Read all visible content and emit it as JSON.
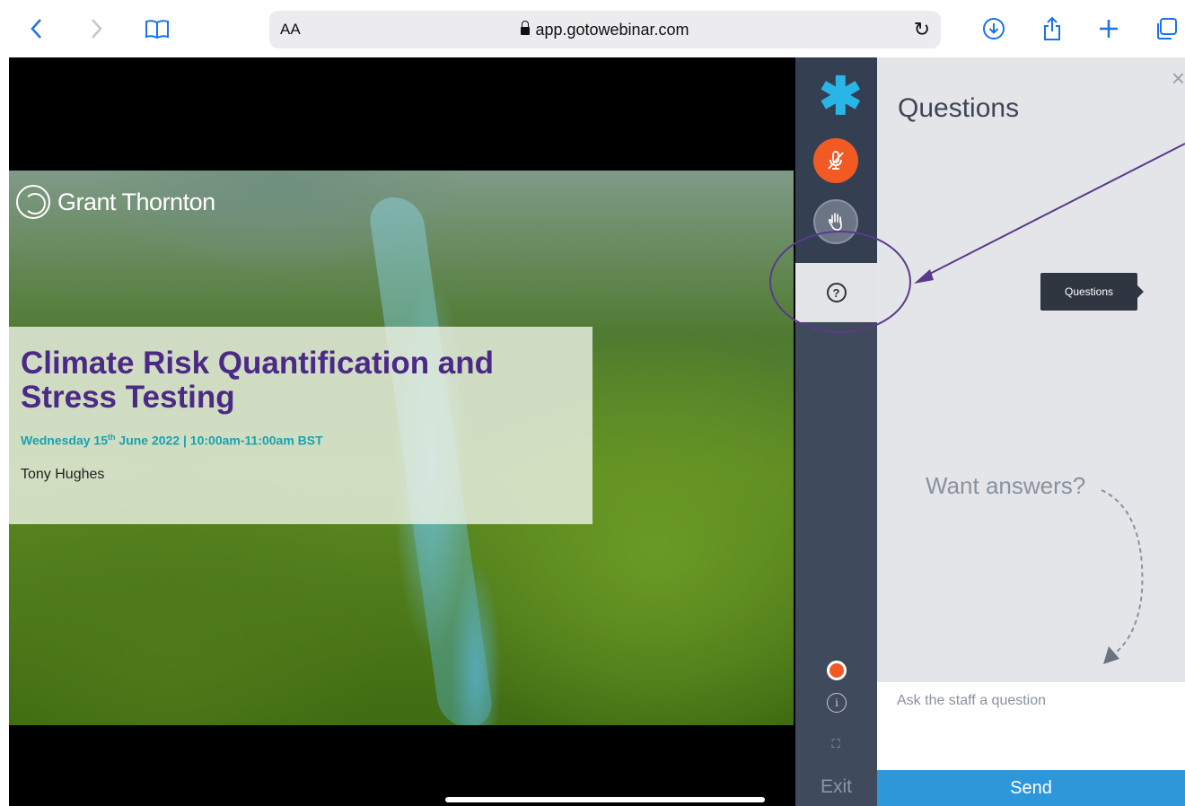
{
  "browser": {
    "url": "app.gotowebinar.com",
    "text_size_label": "AA",
    "icons": [
      "back-icon",
      "forward-icon",
      "bookmarks-icon",
      "lock-icon",
      "reload-icon",
      "download-icon",
      "share-icon",
      "add-tab-icon",
      "tabs-icon"
    ]
  },
  "slide": {
    "logo_text": "Grant Thornton",
    "title": "Climate Risk Quantification and Stress Testing",
    "date_prefix": "Wednesday 15",
    "date_sup": "th",
    "date_suffix": " June 2022 | 10:00am-11:00am BST",
    "presenter": "Tony Hughes"
  },
  "rail": {
    "items": [
      "gotowebinar-logo-icon",
      "microphone-muted-icon",
      "raise-hand-icon",
      "questions-icon",
      "record-icon",
      "info-icon",
      "fullscreen-icon"
    ],
    "exit_label": "Exit"
  },
  "panel": {
    "title": "Questions",
    "tooltip": "Questions",
    "empty_prompt": "Want answers?",
    "input_placeholder": "Ask the staff a question",
    "send_label": "Send"
  },
  "colors": {
    "accent_orange": "#f25a24",
    "send_blue": "#2d97d9",
    "slide_title_purple": "#4b2a86",
    "slide_date_teal": "#16a3b2",
    "annotation_purple": "#5b3a8c"
  }
}
